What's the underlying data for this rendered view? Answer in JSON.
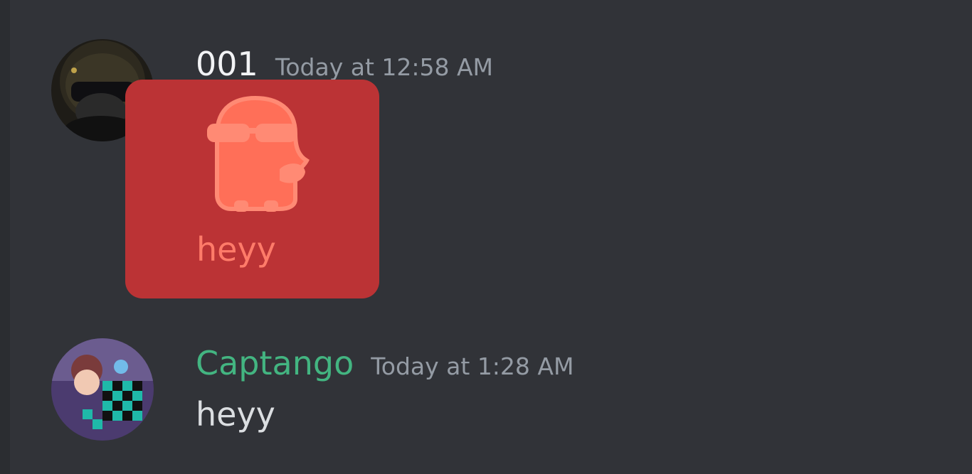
{
  "messages": [
    {
      "username": "001",
      "timestamp": "Today at 12:58 AM",
      "sticker_name": "cool-bird-sticker",
      "content": "heyy",
      "username_color": "#f2f3f5"
    },
    {
      "username": "Captango",
      "timestamp": "Today at 1:28 AM",
      "content": "heyy",
      "username_color": "#43b581"
    }
  ],
  "colors": {
    "background": "#313338",
    "timestamp": "#949ba4",
    "text": "#dbdee1",
    "overlay": "#bb3335",
    "sticker": "#ff7b69"
  }
}
